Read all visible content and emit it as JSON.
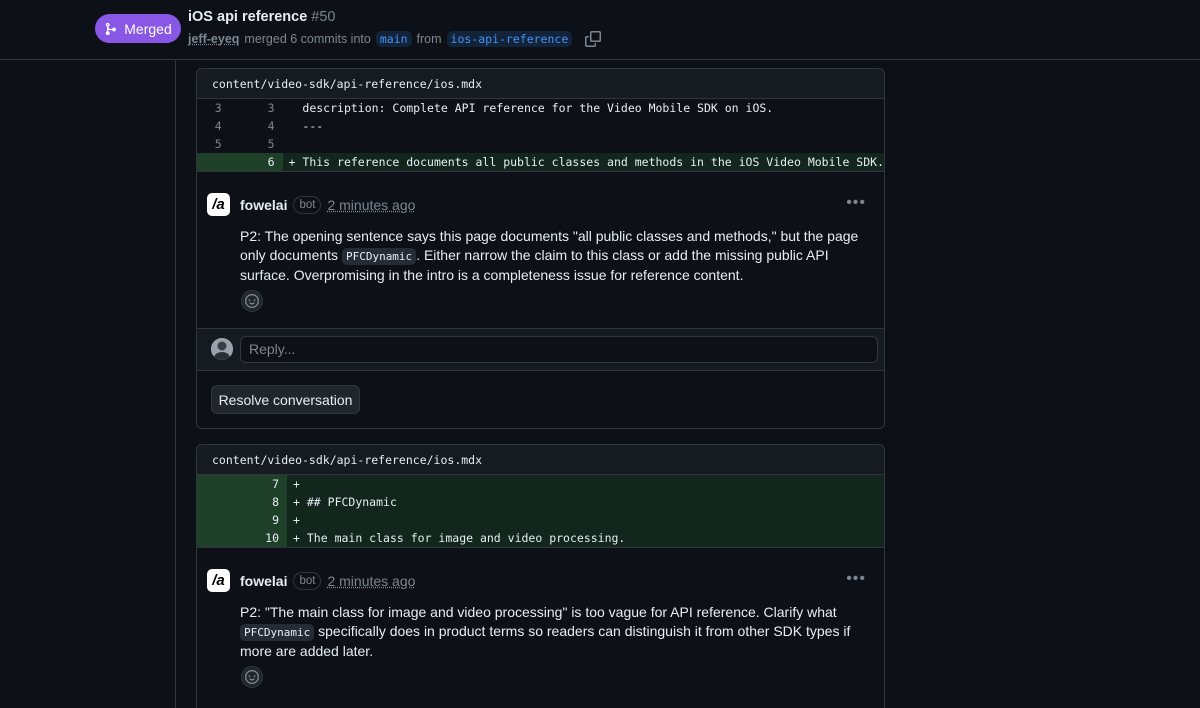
{
  "header": {
    "state": "Merged",
    "title": "iOS api reference",
    "number": "#50",
    "author": "jeff-eyeq",
    "merged_text": "merged 6 commits into",
    "base_branch": "main",
    "from_text": "from",
    "head_branch": "ios-api-reference"
  },
  "threads": [
    {
      "file": "content/video-sdk/api-reference/ios.mdx",
      "lines": [
        {
          "old": "3",
          "new": "3",
          "sign": " ",
          "code": "description: Complete API reference for the Video Mobile SDK on iOS.",
          "type": "ctx"
        },
        {
          "old": "4",
          "new": "4",
          "sign": " ",
          "code": "---",
          "type": "ctx"
        },
        {
          "old": "5",
          "new": "5",
          "sign": " ",
          "code": "",
          "type": "ctx"
        },
        {
          "old": "",
          "new": "6",
          "sign": "+",
          "code": "This reference documents all public classes and methods in the iOS Video Mobile SDK.",
          "type": "add"
        }
      ],
      "comment": {
        "author": "fowelai",
        "badge": "bot",
        "time": "2 minutes ago",
        "body_1": "P2: The opening sentence says this page documents \"all public classes and methods,\" but the page only documents ",
        "code": "PFCDynamic",
        "body_2": ". Either narrow the claim to this class or add the missing public API surface. Overpromising in the intro is a completeness issue for reference content."
      },
      "reply_placeholder": "Reply...",
      "resolve_label": "Resolve conversation"
    },
    {
      "file": "content/video-sdk/api-reference/ios.mdx",
      "lines": [
        {
          "old": "",
          "new": "7",
          "sign": "+",
          "code": "",
          "type": "add"
        },
        {
          "old": "",
          "new": "8",
          "sign": "+",
          "code": "## PFCDynamic",
          "type": "add"
        },
        {
          "old": "",
          "new": "9",
          "sign": "+",
          "code": "",
          "type": "add"
        },
        {
          "old": "",
          "new": "10",
          "sign": "+",
          "code": "The main class for image and video processing.",
          "type": "add"
        }
      ],
      "comment": {
        "author": "fowelai",
        "badge": "bot",
        "time": "2 minutes ago",
        "body_1": "P2: \"The main class for image and video processing\" is too vague for API reference. Clarify what ",
        "code": "PFCDynamic",
        "body_2": " specifically does in product terms so readers can distinguish it from other SDK types if more are added later."
      }
    }
  ],
  "colors": {
    "merged": "#8957e5",
    "addition_bg": "#12261e",
    "addition_gutter": "#1e4028"
  }
}
